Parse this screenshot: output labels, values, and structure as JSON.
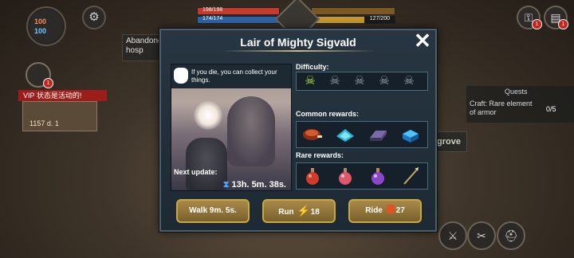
{
  "hud": {
    "food_value": "100",
    "water_value": "100",
    "hp_text": "198/198",
    "energy_text": "174/174",
    "xp_text": "127/200",
    "notif_count": "1",
    "aband_label": "Abandoned hosp",
    "vip_text": "VIP 状态是活动的!",
    "guild_text": "1157 d. 1",
    "quests_title": "Quests",
    "quest_text": "Craft: Rare element of armor",
    "quest_count": "0/5",
    "grove_label": "grove"
  },
  "modal": {
    "title": "Lair of Mighty Sigvald",
    "close_glyph": "✕",
    "die_notice": "If you die, you can collect your things.",
    "next_update_label": "Next update:",
    "timer_text": "13h. 5m. 38s.",
    "difficulty_label": "Difficulty:",
    "difficulty_level": 1,
    "difficulty_max": 5,
    "common_rewards_label": "Common rewards:",
    "common_rewards": [
      "cooked-meat-icon",
      "blue-crystal-icon",
      "metal-ingot-icon",
      "blue-chest-icon"
    ],
    "rare_rewards_label": "Rare rewards:",
    "rare_rewards": [
      "red-potion-icon",
      "pink-potion-icon",
      "purple-potion-icon",
      "spear-icon"
    ],
    "walk_label": "Walk 9m. 5s.",
    "run_label": "Run",
    "run_cost": "18",
    "ride_label": "Ride",
    "ride_cost": "27"
  },
  "colors": {
    "skull_active": "#b6e23c",
    "skull_inactive": "#9aa0a5",
    "hp_bar": "#c43a2f",
    "energy_bar": "#2e64a8",
    "xp_bar": "#c99a2c",
    "button_gold": "#a98a4a"
  }
}
